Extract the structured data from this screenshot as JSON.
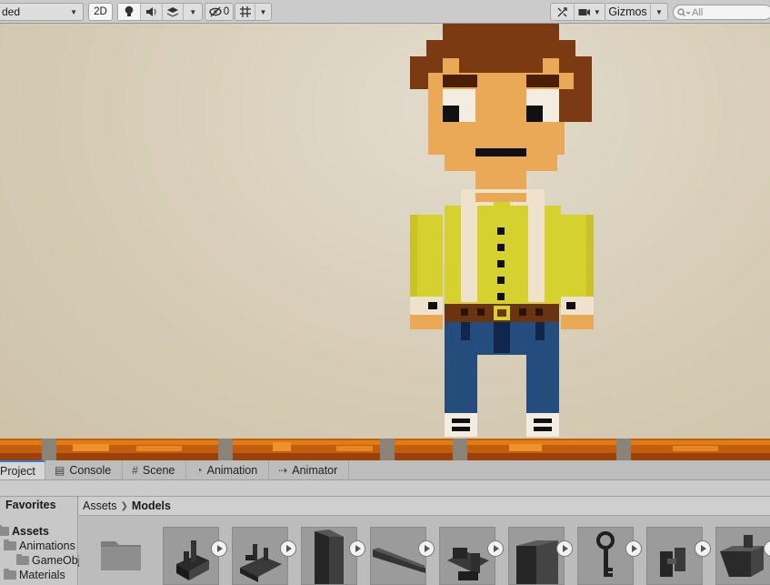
{
  "toolbar": {
    "shading_mode": "ded",
    "mode_2d": "2D",
    "hidden_count": "0",
    "gizmos_label": "Gizmos",
    "search_placeholder": "All"
  },
  "tabs": [
    {
      "label": "Project",
      "icon": "folder-icon"
    },
    {
      "label": "Console",
      "icon": "console-icon"
    },
    {
      "label": "Scene",
      "icon": "grid-icon"
    },
    {
      "label": "Animation",
      "icon": "clock-icon"
    },
    {
      "label": "Animator",
      "icon": "animator-icon"
    }
  ],
  "left_panel": {
    "favorites": "Favorites",
    "tree": [
      {
        "label": "Assets"
      },
      {
        "label": "Animations"
      },
      {
        "label": "GameObj"
      },
      {
        "label": "Materials"
      }
    ]
  },
  "breadcrumb": {
    "root": "Assets",
    "current": "Models"
  },
  "colors": {
    "accent": "#3b7ad8",
    "scene_bg": "#d6ccb6",
    "hair": "#7b3a12",
    "skin": "#e9a957",
    "shirt": "#d5d12e",
    "jeans": "#244c7c"
  }
}
